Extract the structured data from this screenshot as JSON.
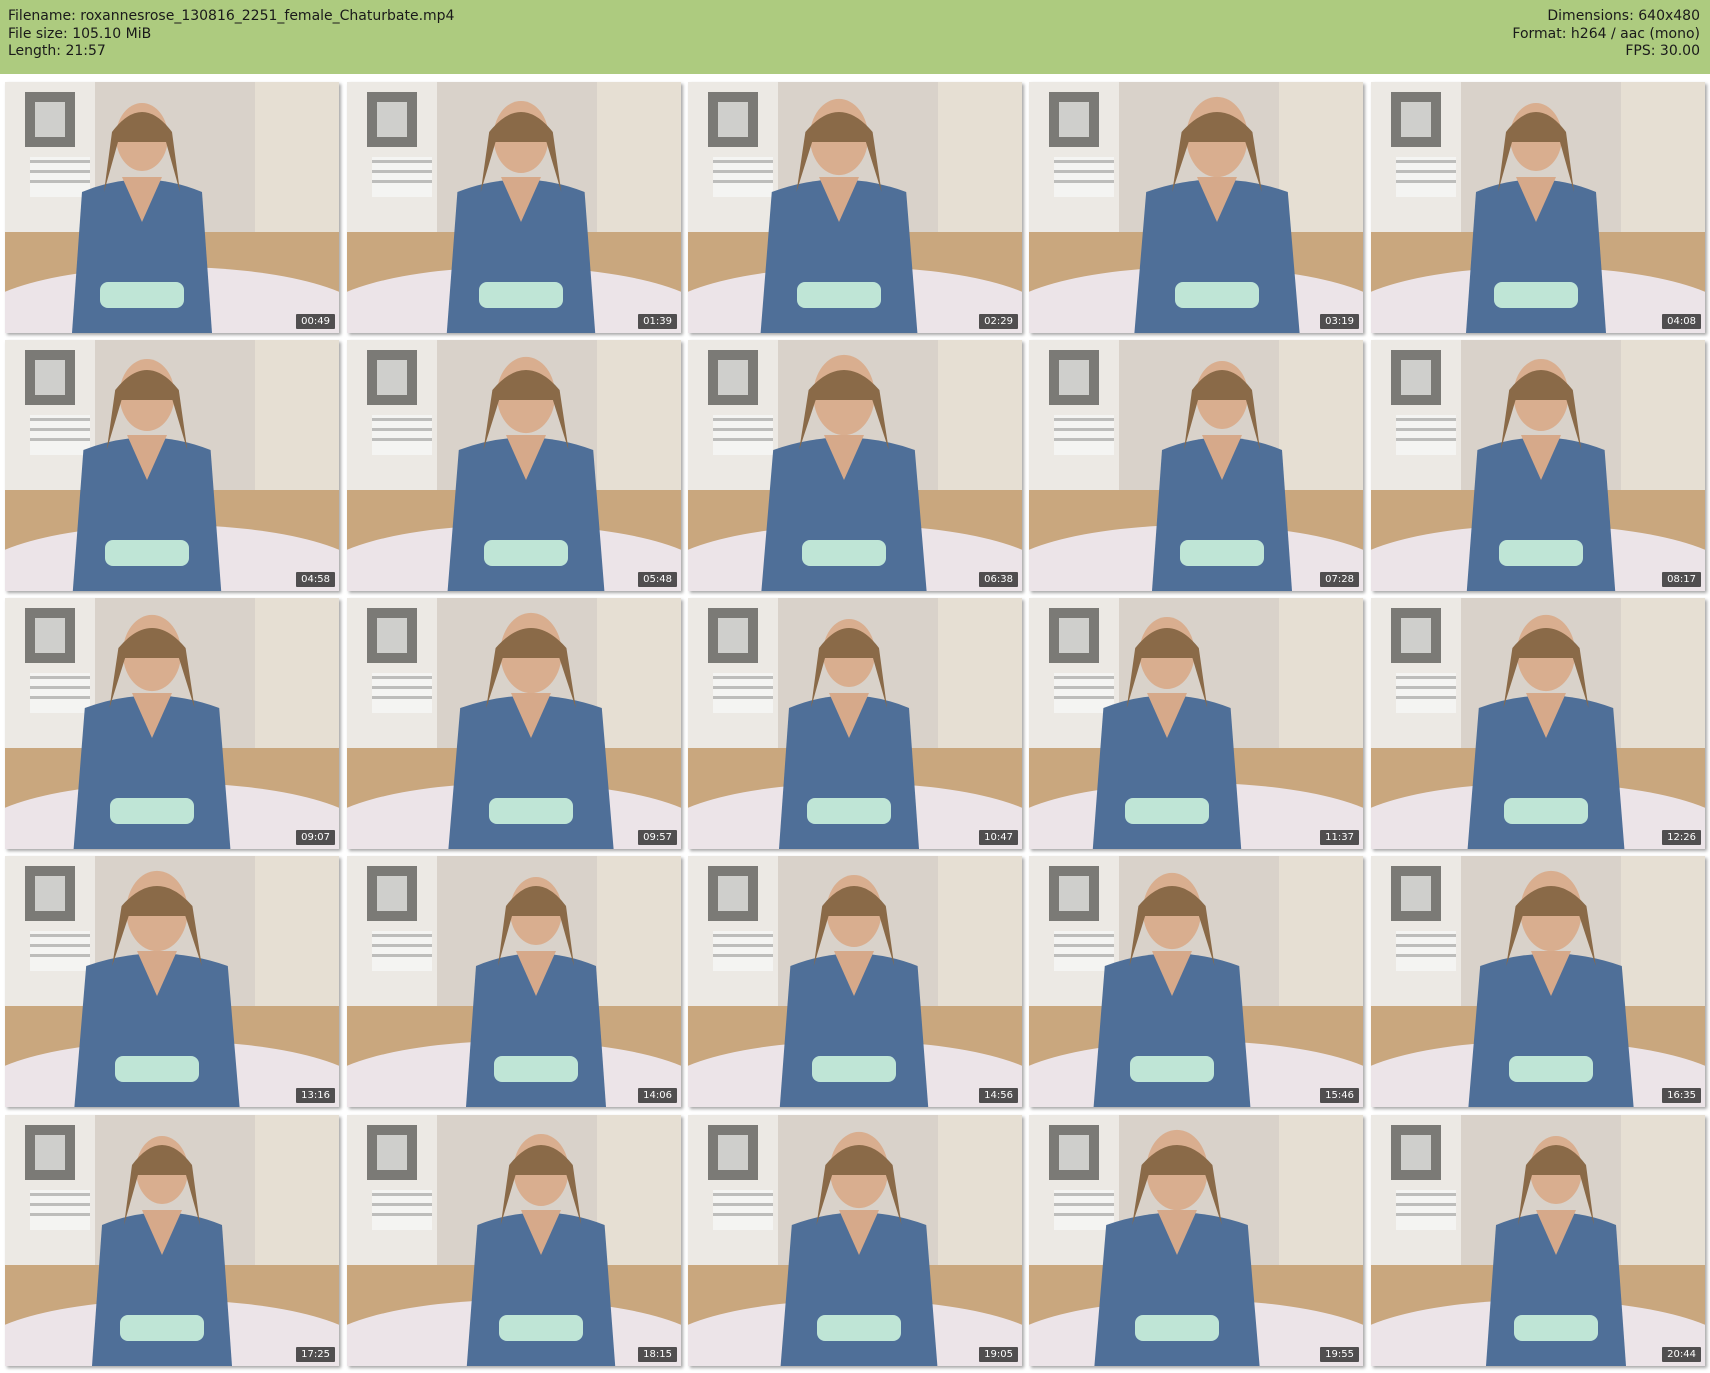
{
  "header": {
    "filename_line": "Filename: roxannesrose_130816_2251_female_Chaturbate.mp4",
    "filesize_line": "File size: 105.10 MiB",
    "length_line": "Length: 21:57",
    "dimensions_line": "Dimensions: 640x480",
    "format_line": "Format: h264 / aac (mono)",
    "fps_line": "FPS: 30.00"
  },
  "colors": {
    "header_bg": "#adcb7f",
    "page_bg": "#ffffff",
    "timestamp_bg": "#222222"
  },
  "thumbnails": [
    {
      "time": "00:49"
    },
    {
      "time": "01:39"
    },
    {
      "time": "02:29"
    },
    {
      "time": "03:19"
    },
    {
      "time": "04:08"
    },
    {
      "time": "04:58"
    },
    {
      "time": "05:48"
    },
    {
      "time": "06:38"
    },
    {
      "time": "07:28"
    },
    {
      "time": "08:17"
    },
    {
      "time": "09:07"
    },
    {
      "time": "09:57"
    },
    {
      "time": "10:47"
    },
    {
      "time": "11:37"
    },
    {
      "time": "12:26"
    },
    {
      "time": "13:16"
    },
    {
      "time": "14:06"
    },
    {
      "time": "14:56"
    },
    {
      "time": "15:46"
    },
    {
      "time": "16:35"
    },
    {
      "time": "17:25"
    },
    {
      "time": "18:15"
    },
    {
      "time": "19:05"
    },
    {
      "time": "19:55"
    },
    {
      "time": "20:44"
    }
  ]
}
